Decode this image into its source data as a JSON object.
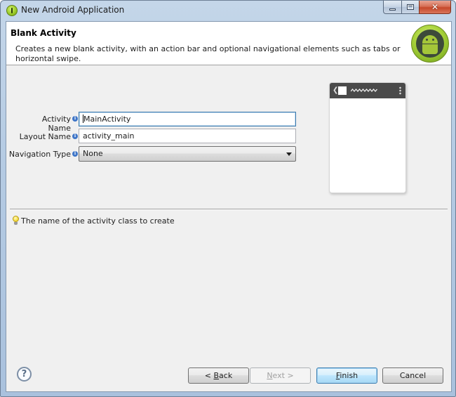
{
  "window": {
    "title": "New Android Application",
    "controls": {
      "minimize": "minimize",
      "maximize": "maximize",
      "close": "✕"
    }
  },
  "header": {
    "title": "Blank Activity",
    "description": "Creates a new blank activity, with an action bar and optional navigational elements such as tabs or horizontal swipe."
  },
  "form": {
    "activity_name": {
      "label": "Activity Name",
      "value": "MainActivity"
    },
    "layout_name": {
      "label": "Layout Name",
      "value": "activity_main"
    },
    "navigation_type": {
      "label": "Navigation Type",
      "value": "None"
    }
  },
  "preview": {
    "back": "❮"
  },
  "hint": {
    "text": "The name of the activity class to create"
  },
  "footer": {
    "help": "?",
    "back_mnemonic": "B",
    "back_rest": "ack",
    "back_prefix": "< ",
    "next_mnemonic": "N",
    "next_rest": "ext >",
    "finish_mnemonic": "F",
    "finish_rest": "inish",
    "cancel": "Cancel"
  },
  "colors": {
    "title_bar": "#b5cbe3",
    "dialog_bg": "#f0f0f0",
    "close_button": "#c6482a",
    "default_button": "#bee6fd",
    "android_green": "#a4c639"
  },
  "icons": {
    "app": "android-app-icon",
    "info": "info-icon",
    "hint": "lightbulb-icon",
    "help": "question-mark-icon"
  }
}
